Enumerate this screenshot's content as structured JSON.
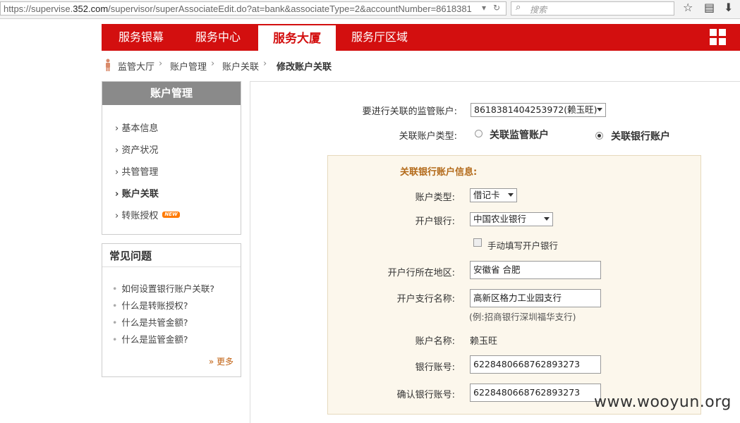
{
  "browser": {
    "url_prefix": "https://supervise.",
    "url_domain": "352.com",
    "url_rest": "/supervisor/superAssociateEdit.do?at=bank&associateType=2&accountNumber=8618381",
    "search_placeholder": "搜索"
  },
  "nav": {
    "items": [
      "服务银幕",
      "服务中心",
      "服务大厦",
      "服务厅区域"
    ],
    "active_index": 2
  },
  "breadcrumb": [
    "监管大厅",
    "账户管理",
    "账户关联",
    "修改账户关联"
  ],
  "sidebar": {
    "title": "账户管理",
    "items": [
      {
        "label": "基本信息"
      },
      {
        "label": "资产状况"
      },
      {
        "label": "共管管理"
      },
      {
        "label": "账户关联",
        "active": true
      },
      {
        "label": "转账授权",
        "badge": "NEW"
      }
    ]
  },
  "faq": {
    "title": "常见问题",
    "items": [
      "如何设置银行账户关联?",
      "什么是转账授权?",
      "什么是共管金额?",
      "什么是监管金额?"
    ],
    "more": "更多"
  },
  "form": {
    "supervise_account_label": "要进行关联的监管账户:",
    "supervise_account_value": "8618381404253972(赖玉旺)",
    "assoc_type_label": "关联账户类型:",
    "radio_supervise": "关联监管账户",
    "radio_bank": "关联银行账户",
    "selected_type": "bank",
    "panel_title": "关联银行账户信息:",
    "account_type_label": "账户类型:",
    "account_type_value": "借记卡",
    "bank_label": "开户银行:",
    "bank_value": "中国农业银行",
    "manual_bank_label": "手动填写开户银行",
    "region_label": "开户行所在地区:",
    "region_value": "安徽省 合肥",
    "branch_label": "开户支行名称:",
    "branch_value": "高新区格力工业园支行",
    "branch_hint": "(例:招商银行深圳福华支行)",
    "account_name_label": "账户名称:",
    "account_name_value": "赖玉旺",
    "bank_number_label": "银行账号:",
    "bank_number_value": "6228480668762893273",
    "confirm_number_label": "确认银行账号:",
    "confirm_number_value": "6228480668762893273"
  },
  "watermark": "www.wooyun.org",
  "colors": {
    "brand": "#d30f0f",
    "panel_bg": "#fcf7ec",
    "panel_title": "#b36a1a"
  }
}
